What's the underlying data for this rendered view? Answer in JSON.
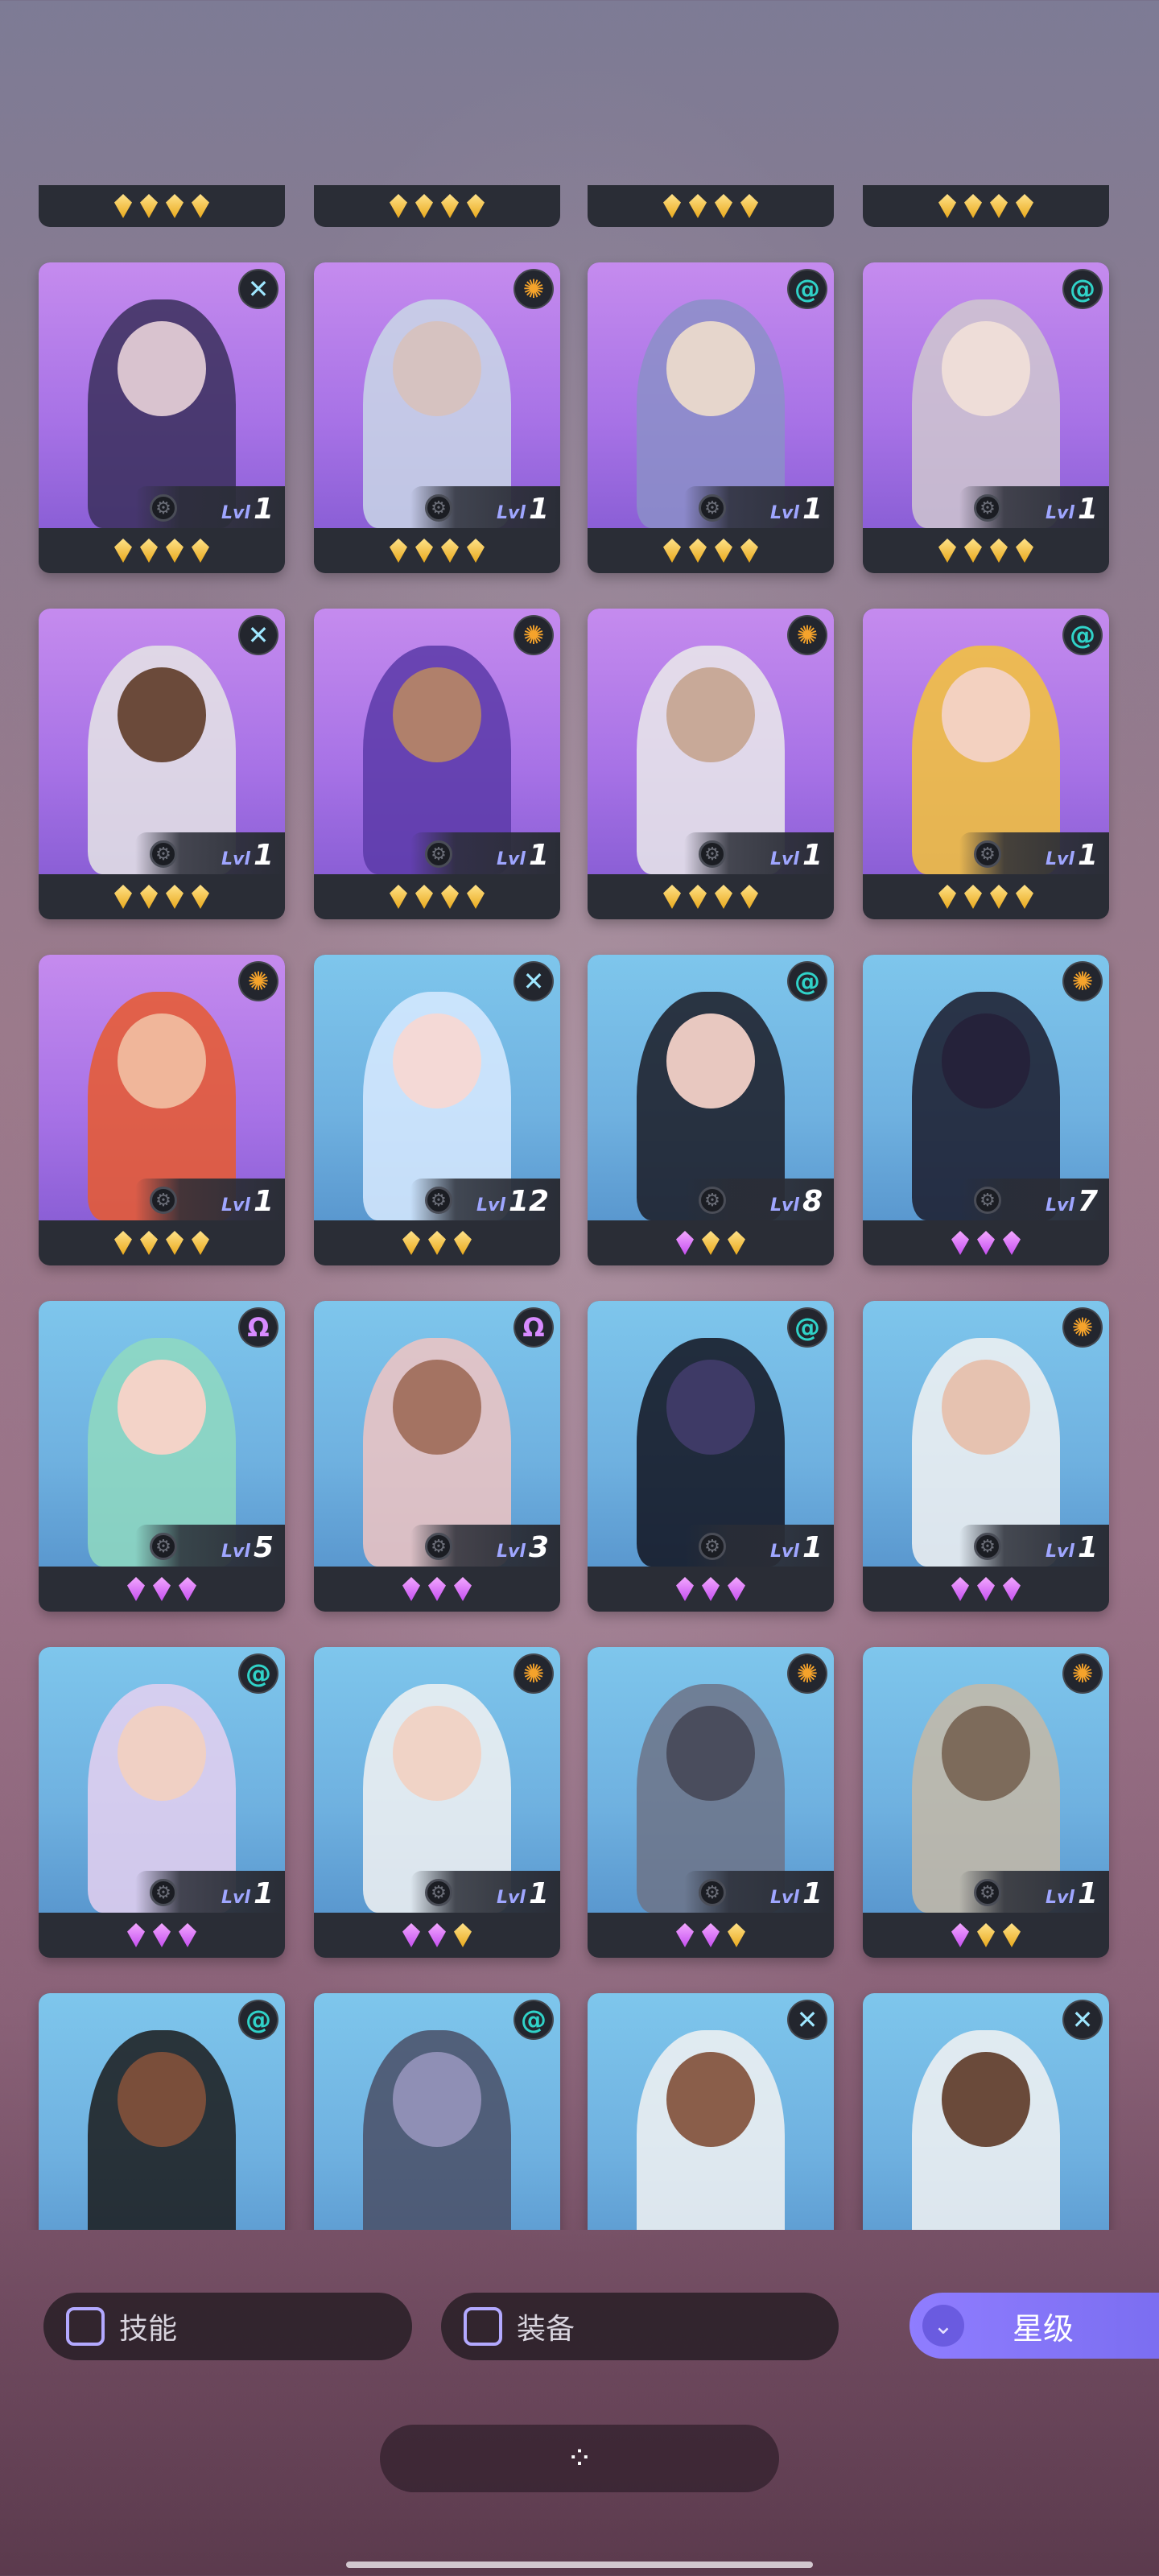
{
  "top_row": [
    {
      "gems": [
        "g",
        "g",
        "g",
        "g"
      ]
    },
    {
      "gems": [
        "g",
        "g",
        "g",
        "g"
      ]
    },
    {
      "gems": [
        "g",
        "g",
        "g",
        "g"
      ]
    },
    {
      "gems": [
        "g",
        "g",
        "g",
        "g"
      ]
    }
  ],
  "rows": [
    [
      {
        "bg": "purple",
        "badge": "x",
        "level": "1",
        "gems": [
          "g",
          "g",
          "g",
          "g"
        ],
        "skin": "#d9c3cf",
        "hair": "#3a2f5c"
      },
      {
        "bg": "purple",
        "badge": "sun",
        "level": "1",
        "gems": [
          "g",
          "g",
          "g",
          "g"
        ],
        "skin": "#d6c2c0",
        "hair": "#c9d7e6"
      },
      {
        "bg": "purple",
        "badge": "spiral",
        "level": "1",
        "gems": [
          "g",
          "g",
          "g",
          "g"
        ],
        "skin": "#e6d6cc",
        "hair": "#8b8fc8"
      },
      {
        "bg": "purple",
        "badge": "spiral",
        "level": "1",
        "gems": [
          "g",
          "g",
          "g",
          "g"
        ],
        "skin": "#eeddd8",
        "hair": "#cfc7cf"
      }
    ],
    [
      {
        "bg": "purple",
        "badge": "x",
        "level": "1",
        "gems": [
          "g",
          "g",
          "g",
          "g"
        ],
        "skin": "#6b4a3a",
        "hair": "#e5e5e5"
      },
      {
        "bg": "purple",
        "badge": "sun",
        "level": "1",
        "gems": [
          "g",
          "g",
          "g",
          "g"
        ],
        "skin": "#b0806b",
        "hair": "#5b3aa8"
      },
      {
        "bg": "purple",
        "badge": "sun",
        "level": "1",
        "gems": [
          "g",
          "g",
          "g",
          "g"
        ],
        "skin": "#c8a998",
        "hair": "#eaeaea"
      },
      {
        "bg": "purple",
        "badge": "spiral",
        "level": "1",
        "gems": [
          "g",
          "g",
          "g",
          "g"
        ],
        "skin": "#f3d1c0",
        "hair": "#f4c33a"
      }
    ],
    [
      {
        "bg": "purple",
        "badge": "sun",
        "level": "1",
        "gems": [
          "g",
          "g",
          "g",
          "g"
        ],
        "skin": "#f0b69a",
        "hair": "#e75a2e"
      },
      {
        "bg": "blue",
        "badge": "x",
        "level": "12",
        "gems": [
          "g",
          "g",
          "g"
        ],
        "skin": "#f4d9d6",
        "hair": "#d8eaff"
      },
      {
        "bg": "blue",
        "badge": "spiral",
        "level": "8",
        "gems": [
          "p",
          "g",
          "g"
        ],
        "skin": "#e8c8c0",
        "hair": "#1b1b24"
      },
      {
        "bg": "blue",
        "badge": "sun",
        "level": "7",
        "gems": [
          "p",
          "p",
          "p"
        ],
        "skin": "#25223a",
        "hair": "#1b1b2c"
      }
    ],
    [
      {
        "bg": "blue",
        "badge": "omega",
        "level": "5",
        "gems": [
          "p",
          "p",
          "p"
        ],
        "skin": "#f3d3c8",
        "hair": "#8fd9bf"
      },
      {
        "bg": "blue",
        "badge": "omega",
        "level": "3",
        "gems": [
          "p",
          "p",
          "p"
        ],
        "skin": "#a47362",
        "hair": "#f0c4c2"
      },
      {
        "bg": "blue",
        "badge": "spiral",
        "level": "1",
        "gems": [
          "p",
          "p",
          "p"
        ],
        "skin": "#3e3a66",
        "hair": "#12131e"
      },
      {
        "bg": "blue",
        "badge": "sun",
        "level": "1",
        "gems": [
          "p",
          "p",
          "p"
        ],
        "skin": "#e6c2b0",
        "hair": "#f2f2f2"
      }
    ],
    [
      {
        "bg": "blue",
        "badge": "spiral",
        "level": "1",
        "gems": [
          "p",
          "p",
          "p"
        ],
        "skin": "#f0d0c4",
        "hair": "#e5d0f0"
      },
      {
        "bg": "blue",
        "badge": "sun",
        "level": "1",
        "gems": [
          "p",
          "p",
          "g"
        ],
        "skin": "#f0d3c6",
        "hair": "#f2f2f2"
      },
      {
        "bg": "blue",
        "badge": "sun",
        "level": "1",
        "gems": [
          "p",
          "p",
          "g"
        ],
        "skin": "#4a4d5d",
        "hair": "#6d7387"
      },
      {
        "bg": "blue",
        "badge": "sun",
        "level": "1",
        "gems": [
          "p",
          "g",
          "g"
        ],
        "skin": "#7d6b5b",
        "hair": "#c6b8a6"
      }
    ],
    [
      {
        "bg": "blue",
        "badge": "spiral",
        "level": "",
        "gems": [],
        "skin": "#7a4e3a",
        "hair": "#1b1b1b"
      },
      {
        "bg": "blue",
        "badge": "spiral",
        "level": "",
        "gems": [],
        "skin": "#8f8fb5",
        "hair": "#4a4f66"
      },
      {
        "bg": "blue",
        "badge": "x",
        "level": "",
        "gems": [],
        "skin": "#8a5e4a",
        "hair": "#f2f2f2"
      },
      {
        "bg": "blue",
        "badge": "x",
        "level": "",
        "gems": [],
        "skin": "#6a4a3a",
        "hair": "#f2f2f2"
      }
    ]
  ],
  "ui": {
    "level_label": "Lvl",
    "filter_skill": "技能",
    "filter_equip": "装备",
    "star_button": "星级",
    "bottom_icon": "⁘"
  },
  "icons": {
    "x": "✕",
    "sun": "✺",
    "spiral": "@",
    "omega": "Ω",
    "gear": "⚙",
    "chevron": "⌄"
  }
}
